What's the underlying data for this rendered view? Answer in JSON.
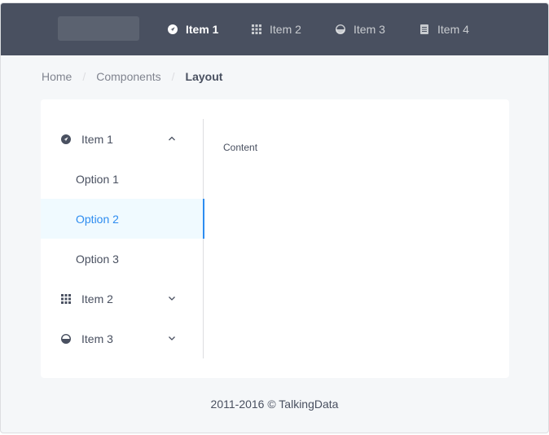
{
  "header": {
    "nav": [
      {
        "label": "Item 1",
        "icon": "navigate-icon",
        "active": true
      },
      {
        "label": "Item 2",
        "icon": "grid-icon",
        "active": false
      },
      {
        "label": "Item 3",
        "icon": "pie-icon",
        "active": false
      },
      {
        "label": "Item 4",
        "icon": "document-icon",
        "active": false
      }
    ]
  },
  "breadcrumb": {
    "items": [
      "Home",
      "Components",
      "Layout"
    ],
    "separator": "/"
  },
  "sidebar": {
    "item1": {
      "label": "Item 1",
      "icon": "navigate-icon",
      "expanded": true
    },
    "options": [
      {
        "label": "Option 1",
        "active": false
      },
      {
        "label": "Option 2",
        "active": true
      },
      {
        "label": "Option 3",
        "active": false
      }
    ],
    "item2": {
      "label": "Item 2",
      "icon": "grid-icon",
      "expanded": false
    },
    "item3": {
      "label": "Item 3",
      "icon": "pie-icon",
      "expanded": false
    }
  },
  "content": {
    "text": "Content"
  },
  "footer": {
    "text": "2011-2016 © TalkingData"
  },
  "colors": {
    "header_bg": "#495060",
    "accent": "#2d8cf0",
    "page_bg": "#f5f7f9"
  }
}
